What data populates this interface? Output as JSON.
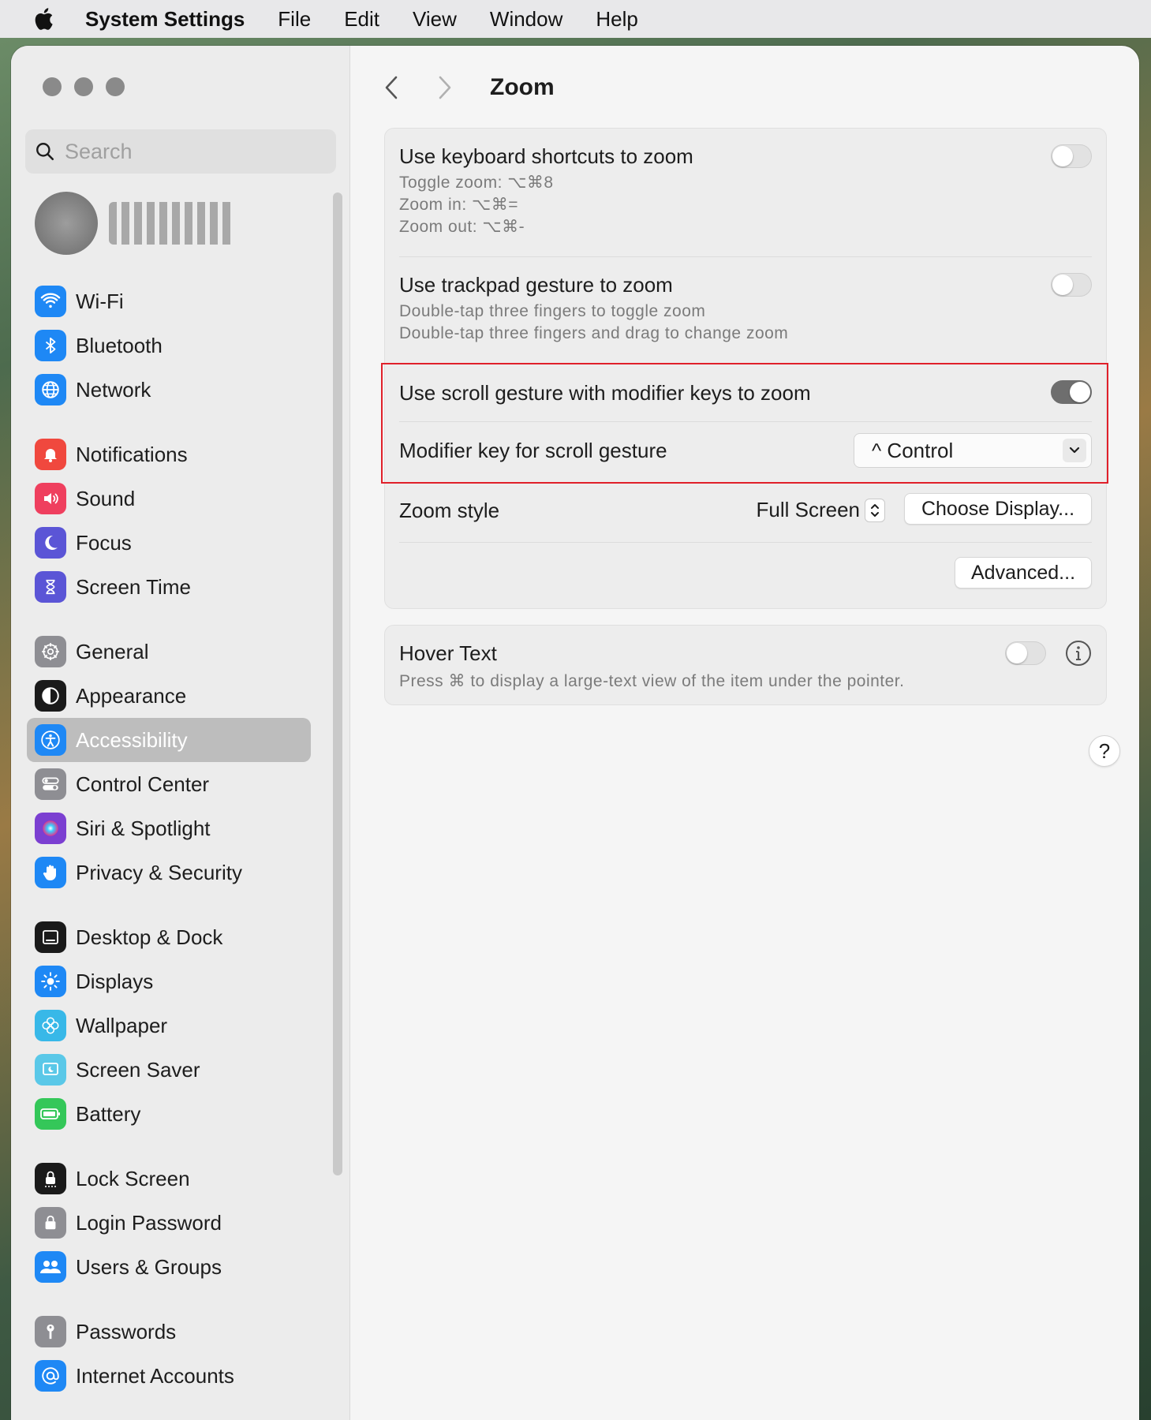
{
  "menubar": {
    "app_name": "System Settings",
    "items": [
      "File",
      "Edit",
      "View",
      "Window",
      "Help"
    ]
  },
  "sidebar": {
    "search_placeholder": "Search",
    "items": [
      {
        "label": "Wi-Fi",
        "icon": "wifi-icon",
        "color": "#1e88f5"
      },
      {
        "label": "Bluetooth",
        "icon": "bluetooth-icon",
        "color": "#1e88f5"
      },
      {
        "label": "Network",
        "icon": "globe-icon",
        "color": "#1e88f5"
      },
      {
        "label": "Notifications",
        "icon": "bell-icon",
        "color": "#f0483e"
      },
      {
        "label": "Sound",
        "icon": "speaker-icon",
        "color": "#ef3f5e"
      },
      {
        "label": "Focus",
        "icon": "moon-icon",
        "color": "#5b55d6"
      },
      {
        "label": "Screen Time",
        "icon": "hourglass-icon",
        "color": "#5b55d6"
      },
      {
        "label": "General",
        "icon": "gear-icon",
        "color": "#8e8e93"
      },
      {
        "label": "Appearance",
        "icon": "appearance-icon",
        "color": "#1a1a1a"
      },
      {
        "label": "Accessibility",
        "icon": "accessibility-icon",
        "color": "#1e88f5"
      },
      {
        "label": "Control Center",
        "icon": "control-center-icon",
        "color": "#8e8e93"
      },
      {
        "label": "Siri & Spotlight",
        "icon": "siri-icon",
        "color": "#7b3fd1"
      },
      {
        "label": "Privacy & Security",
        "icon": "hand-icon",
        "color": "#1e88f5"
      },
      {
        "label": "Desktop & Dock",
        "icon": "dock-icon",
        "color": "#1a1a1a"
      },
      {
        "label": "Displays",
        "icon": "sun-icon",
        "color": "#1e88f5"
      },
      {
        "label": "Wallpaper",
        "icon": "flower-icon",
        "color": "#38b8e8"
      },
      {
        "label": "Screen Saver",
        "icon": "screen-saver-icon",
        "color": "#5ac8e8"
      },
      {
        "label": "Battery",
        "icon": "battery-icon",
        "color": "#34c759"
      },
      {
        "label": "Lock Screen",
        "icon": "lock-screen-icon",
        "color": "#1a1a1a"
      },
      {
        "label": "Login Password",
        "icon": "lock-icon",
        "color": "#8e8e93"
      },
      {
        "label": "Users & Groups",
        "icon": "users-icon",
        "color": "#1e88f5"
      },
      {
        "label": "Passwords",
        "icon": "key-icon",
        "color": "#8e8e93"
      },
      {
        "label": "Internet Accounts",
        "icon": "at-icon",
        "color": "#1e88f5"
      }
    ]
  },
  "main": {
    "title": "Zoom",
    "keyboard": {
      "title": "Use keyboard shortcuts to zoom",
      "lines": [
        "Toggle zoom: ⌥⌘8",
        "Zoom in: ⌥⌘=",
        "Zoom out: ⌥⌘-"
      ],
      "enabled": false
    },
    "trackpad": {
      "title": "Use trackpad gesture to zoom",
      "lines": [
        "Double-tap three fingers to toggle zoom",
        "Double-tap three fingers and drag to change zoom"
      ],
      "enabled": false
    },
    "scroll": {
      "title": "Use scroll gesture with modifier keys to zoom",
      "enabled": true
    },
    "modifier": {
      "label": "Modifier key for scroll gesture",
      "value": "^ Control"
    },
    "zoom_style": {
      "label": "Zoom style",
      "value": "Full Screen",
      "choose_display": "Choose Display...",
      "advanced": "Advanced..."
    },
    "hover_text": {
      "title": "Hover Text",
      "desc": "Press ⌘ to display a large-text view of the item under the pointer.",
      "enabled": false
    },
    "help": "?"
  },
  "colors": {
    "highlight": "#e0202a",
    "selected": "#bdbdbd"
  }
}
